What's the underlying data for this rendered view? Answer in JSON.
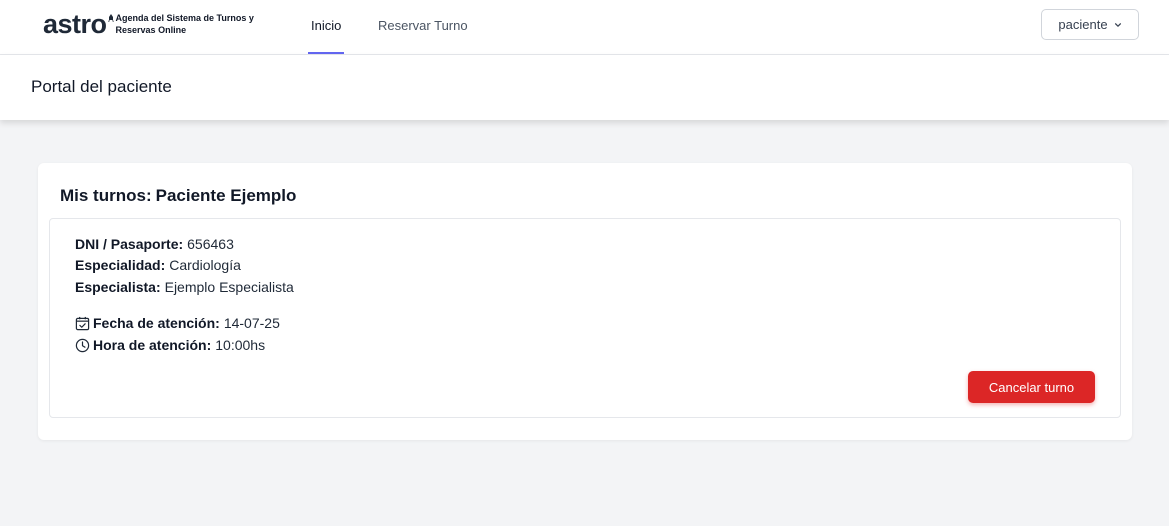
{
  "brand": {
    "name": "astro",
    "tagline": "Agenda del Sistema de Turnos y Reservas Online"
  },
  "nav": {
    "items": [
      {
        "label": "Inicio",
        "active": true
      },
      {
        "label": "Reservar Turno",
        "active": false
      }
    ],
    "user_menu": {
      "label": "paciente",
      "icon": "chevron-down-icon"
    }
  },
  "header": {
    "title": "Portal del paciente"
  },
  "turnos": {
    "heading": "Mis turnos:",
    "patient_name": "Paciente Ejemplo",
    "appointment": {
      "dni_label": "DNI / Pasaporte:",
      "dni_value": "656463",
      "especialidad_label": "Especialidad:",
      "especialidad_value": "Cardiología",
      "especialista_label": "Especialista:",
      "especialista_value": "Ejemplo Especialista",
      "fecha_label": "Fecha de atención:",
      "fecha_value": "14-07-25",
      "fecha_icon": "calendar-check-icon",
      "hora_label": "Hora de atención:",
      "hora_value": "10:00hs",
      "hora_icon": "clock-icon",
      "cancel_label": "Cancelar turno"
    }
  },
  "colors": {
    "accent": "#6366f1",
    "danger": "#dc2626",
    "background": "#f3f4f6"
  }
}
